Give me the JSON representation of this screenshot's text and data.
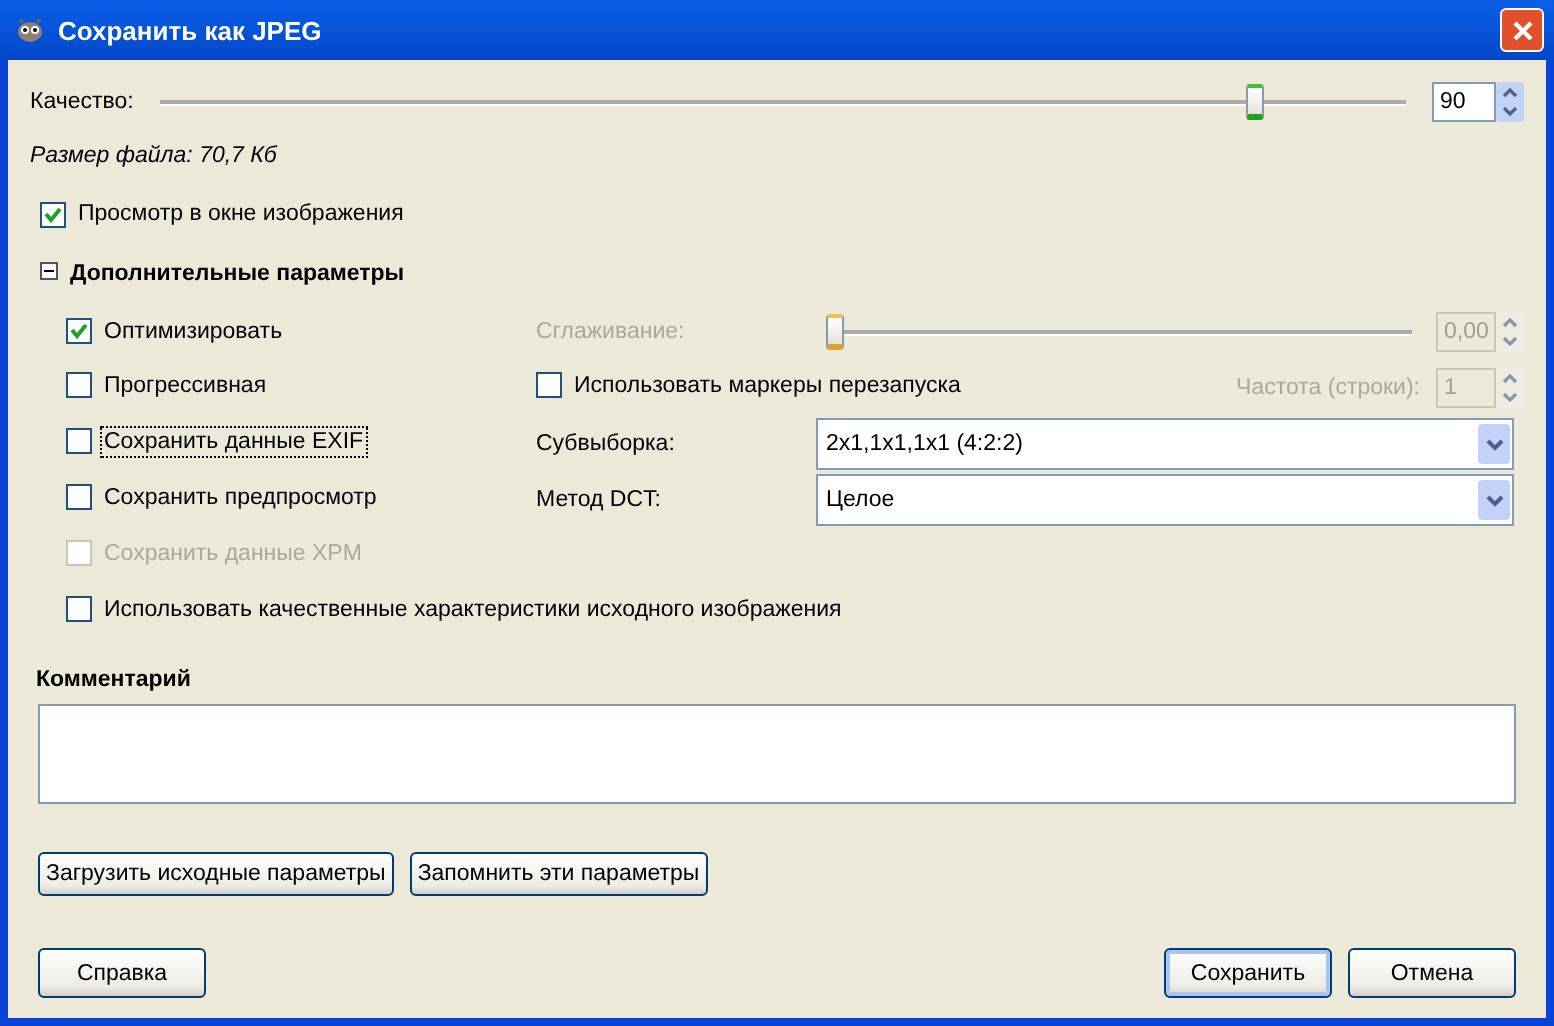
{
  "window": {
    "title": "Сохранить как JPEG"
  },
  "quality": {
    "label": "Качество:",
    "level": 0.884,
    "value": "90"
  },
  "file_size": "Размер файла: 70,7 Кб",
  "preview": {
    "label": "Просмотр в окне изображения",
    "checked": true
  },
  "advanced": {
    "title": "Дополнительные параметры",
    "expanded": true,
    "rows": [
      {
        "check": {
          "label": "Оптимизировать",
          "checked": true,
          "disabled": false,
          "focused": false
        },
        "control": {
          "kind": "slider",
          "label": "Сглаживание:",
          "level": 0,
          "value": "0,00",
          "disabled": true
        }
      },
      {
        "check": {
          "label": "Прогрессивная",
          "checked": false,
          "disabled": false,
          "focused": false
        },
        "control": {
          "kind": "check-spin",
          "check": {
            "label": "Использовать маркеры перезапуска",
            "checked": false
          },
          "label": "Частота (строки):",
          "value": "1",
          "disabled": true
        }
      },
      {
        "check": {
          "label": "Сохранить данные EXIF",
          "checked": false,
          "disabled": false,
          "focused": true
        },
        "control": {
          "kind": "select",
          "label": "Субвыборка:",
          "value": "2x1,1x1,1x1 (4:2:2)"
        }
      },
      {
        "check": {
          "label": "Сохранить предпросмотр",
          "checked": false,
          "disabled": false,
          "focused": false
        },
        "control": {
          "kind": "select",
          "label": "Метод DCT:",
          "value": "Целое"
        }
      },
      {
        "check": {
          "label": "Сохранить данные XPM",
          "checked": false,
          "disabled": true,
          "focused": false
        }
      },
      {
        "check": {
          "label": "Использовать качественные характеристики исходного изображения",
          "checked": false,
          "disabled": false,
          "focused": false
        }
      }
    ]
  },
  "comment": {
    "label": "Комментарий"
  },
  "preset_buttons": [
    "Загрузить исходные параметры",
    "Запомнить эти параметры"
  ],
  "help_button": "Справка",
  "dialog_buttons": [
    {
      "label": "Сохранить",
      "default": true
    },
    {
      "label": "Отмена",
      "default": false
    }
  ]
}
